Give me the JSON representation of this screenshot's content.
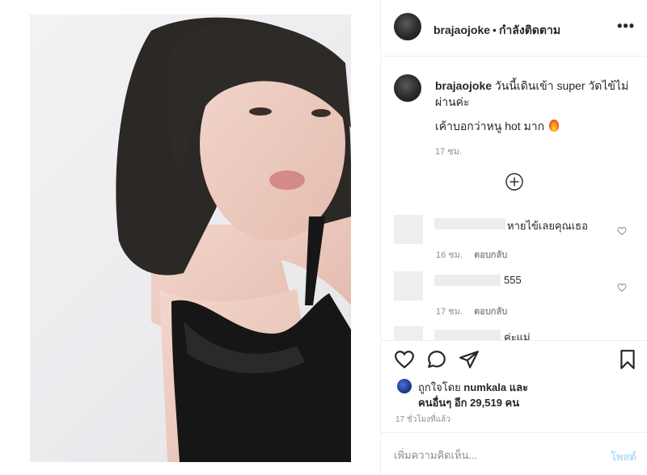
{
  "post": {
    "username": "brajaojoke",
    "dot": "•",
    "follow_status": "กำลังติดตาม",
    "more": "•••"
  },
  "caption": {
    "username": "brajaojoke",
    "text": "วันนี้เดินเข้า super วัดไข้ไม่ผ่านค่ะ",
    "line2": "เค้าบอกว่าหนู hot มาก",
    "emoji_icon": "fire-icon",
    "time": "17 ชม."
  },
  "comments": [
    {
      "text": "หายไข้เลยคุณเธอ",
      "time": "16 ชม.",
      "reply": "ตอบกลับ"
    },
    {
      "text": "555",
      "time": "17 ชม.",
      "reply": "ตอบกลับ"
    },
    {
      "text": "ค่ะแม่",
      "time": "",
      "reply": ""
    }
  ],
  "likes": {
    "prefix": "ถูกใจโดย",
    "liker": "numkala",
    "and": "และ",
    "others": "คนอื่นๆ อีก 29,519 คน"
  },
  "posted_time": "17 ชั่วโมงที่แล้ว",
  "composer": {
    "placeholder": "เพิ่มความคิดเห็น...",
    "post_label": "โพสต์"
  },
  "colors": {
    "text": "#262626",
    "muted": "#8e8e8e",
    "border": "#efefef",
    "post_disabled": "#b2dffc"
  }
}
